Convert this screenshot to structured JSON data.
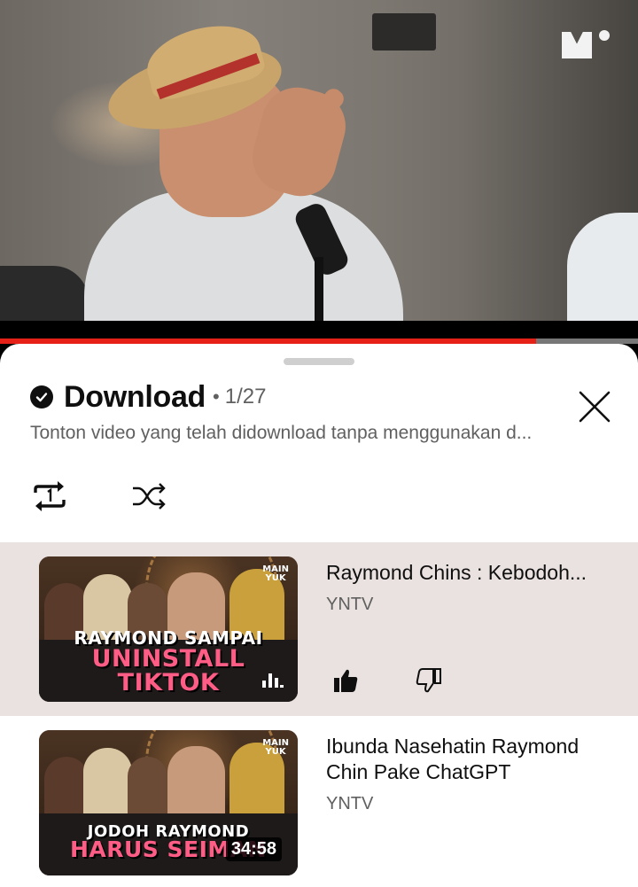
{
  "video": {
    "progress_fraction": 0.84
  },
  "playlist": {
    "title": "Download",
    "separator": "•",
    "counter": "1/27",
    "subtitle": "Tonton video yang telah didownload tanpa menggunakan d..."
  },
  "items": [
    {
      "title": "Raymond Chins : Kebodoh...",
      "channel": "YNTV",
      "thumb_badge": "MAIN\nYUK",
      "thumb_caption": [
        "RAYMOND SAMPAI",
        "UNINSTALL",
        "TIKTOK"
      ],
      "now_playing": true
    },
    {
      "title": "Ibunda Nasehatin Raymond Chin Pake ChatGPT",
      "channel": "YNTV",
      "thumb_badge": "MAIN\nYUK",
      "thumb_caption": [
        "JODOH RAYMOND",
        "HARUS SEIMAN"
      ],
      "duration": "34:58"
    }
  ],
  "colors": {
    "progress": "#e62117",
    "active_row": "#eae2e0",
    "caption_pink": "#ff5c86"
  },
  "icons": {
    "close": "close-icon",
    "loop": "repeat-one-icon",
    "shuffle": "shuffle-icon",
    "like": "thumbs-up-icon",
    "dislike": "thumbs-down-icon",
    "check": "check-circle-icon"
  }
}
